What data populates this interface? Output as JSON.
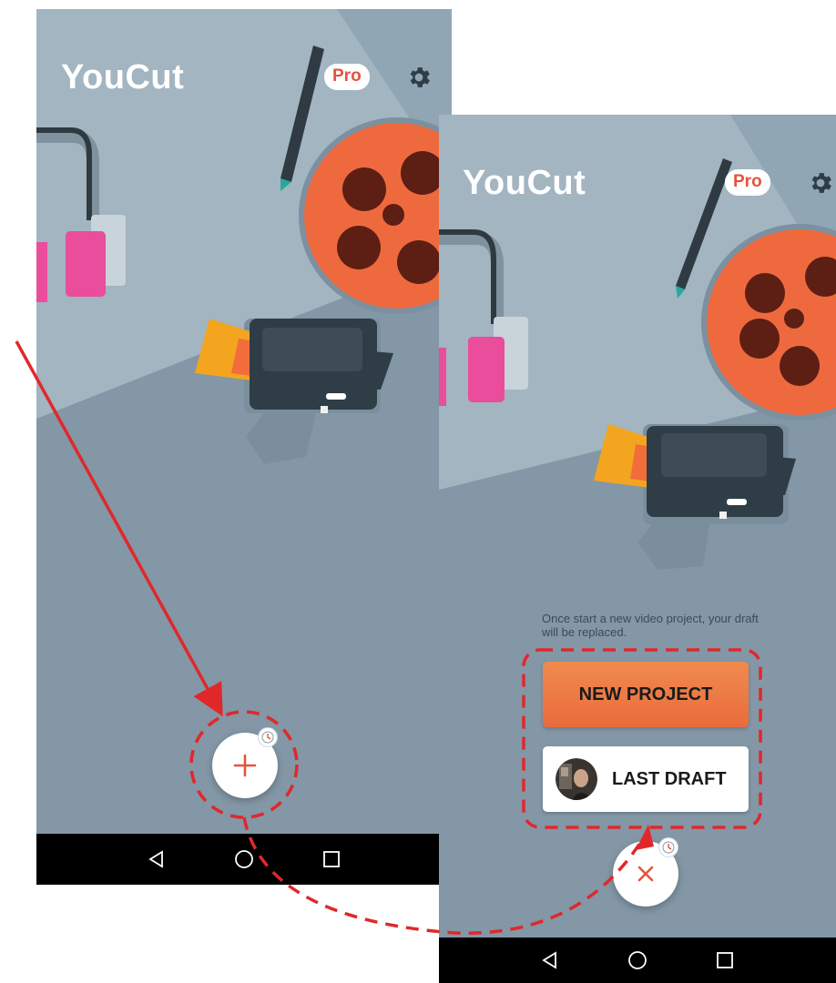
{
  "left_screen": {
    "app_title": "YouCut",
    "pro_badge": "Pro",
    "settings_icon": "gear-icon",
    "fab": {
      "icon": "plus-icon",
      "badge_icon": "clock-icon"
    },
    "navbar": [
      "back-icon",
      "home-icon",
      "recents-icon"
    ]
  },
  "right_screen": {
    "app_title": "YouCut",
    "pro_badge": "Pro",
    "settings_icon": "gear-icon",
    "hint_text": "Once start a new video project, your draft will be replaced.",
    "new_project_label": "NEW PROJECT",
    "last_draft_label": "LAST DRAFT",
    "fab": {
      "icon": "close-icon",
      "badge_icon": "clock-icon"
    },
    "navbar": [
      "back-icon",
      "home-icon",
      "recents-icon"
    ]
  },
  "colors": {
    "background": "#8397a6",
    "light_panel": "#a2b5c1",
    "accent": "#e5533d",
    "button_orange": "#ec7743",
    "annotation_red": "#e0282b"
  }
}
